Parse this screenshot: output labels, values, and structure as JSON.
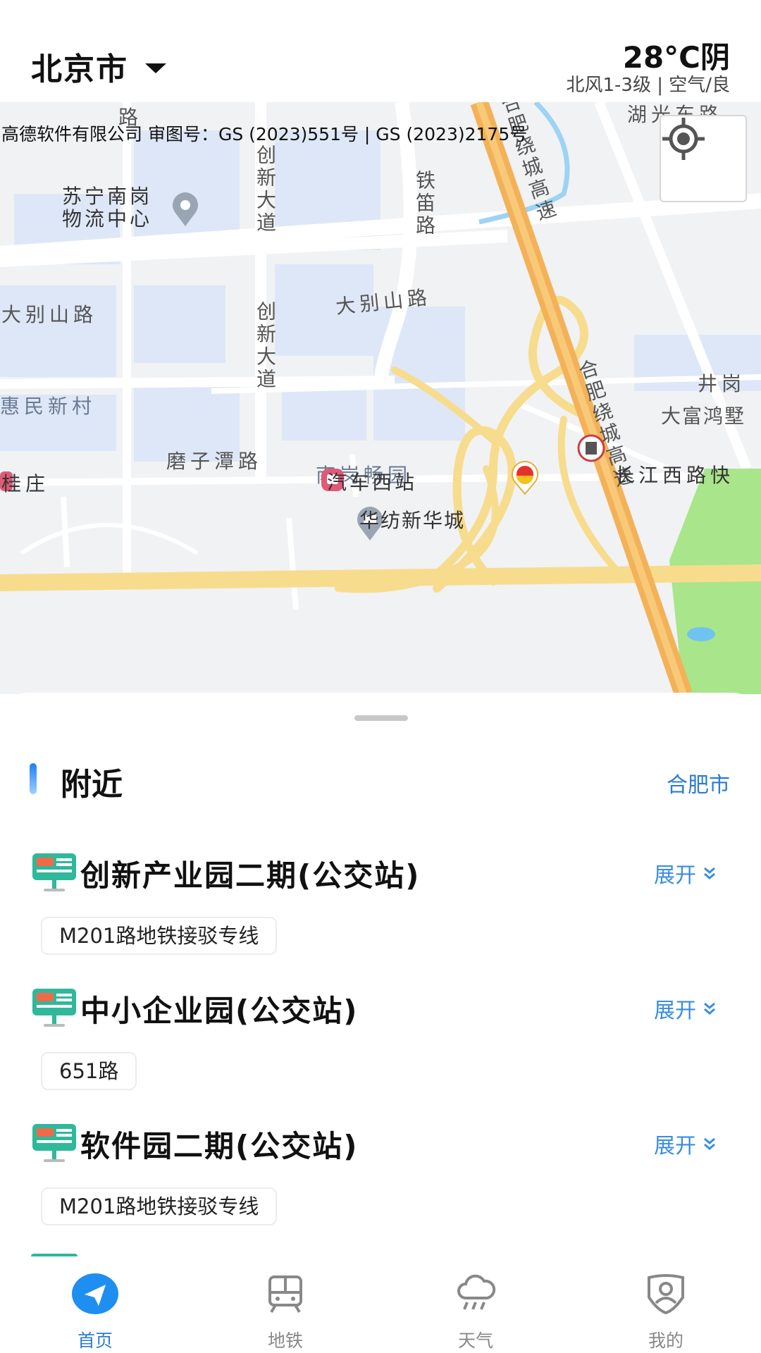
{
  "header": {
    "city": "北京市",
    "temperature": "28°C阴",
    "weather_detail": "北风1-3级 | 空气/良"
  },
  "map": {
    "copyright": "高德软件有限公司 审图号：GS (2023)551号 | GS (2023)2175号",
    "labels": {
      "hubei_road": "湖光东路",
      "road_top": "路",
      "chuangxin_avenue_1": "创新大道",
      "chuangxin_avenue_2": "创新大道",
      "suning": "苏宁南岗物流中心",
      "tiedi_road": "铁笛路",
      "ring_expressway_1": "合肥绕城高速",
      "ring_expressway_2": "合肥绕城高速",
      "dabieshan_road_1": "大别山路",
      "dabieshan_road_2": "大别山路",
      "jinggang": "井岗",
      "huimin": "惠民新村",
      "dafu": "大富鸿墅",
      "mozitan": "磨子潭路",
      "nangang": "南岗畅园",
      "guizhuang": "桂庄",
      "bus_west": "汽车西站",
      "changjiang": "长江西路快",
      "huafang": "华纺新华城"
    },
    "icons": {
      "locate": "locate-crosshair-icon",
      "poi": "map-pin-icon"
    }
  },
  "nearby": {
    "title": "附近",
    "city": "合肥市",
    "expand_label": "展开",
    "stops": [
      {
        "name": "创新产业园二期(公交站)",
        "route": "M201路地铁接驳专线"
      },
      {
        "name": "中小企业园(公交站)",
        "route": "651路"
      },
      {
        "name": "软件园二期(公交站)",
        "route": "M201路地铁接驳专线"
      }
    ]
  },
  "tabs": [
    {
      "label": "首页",
      "icon": "navigation-arrow-icon",
      "active": true
    },
    {
      "label": "地铁",
      "icon": "subway-icon",
      "active": false
    },
    {
      "label": "天气",
      "icon": "weather-rain-icon",
      "active": false
    },
    {
      "label": "我的",
      "icon": "profile-icon",
      "active": false
    }
  ],
  "colors": {
    "accent": "#2a7cd4",
    "expressway": "#f3b258",
    "road_yellow": "#f7dc8e",
    "park_green": "#a9e58a"
  }
}
